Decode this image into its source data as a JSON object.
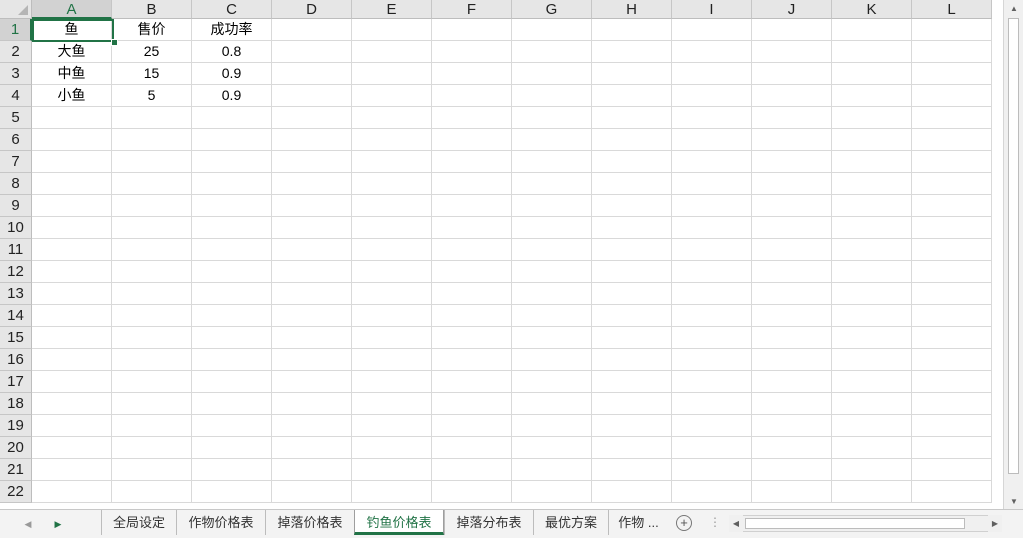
{
  "spreadsheet": {
    "selected_cell": "A1",
    "columns": [
      "A",
      "B",
      "C",
      "D",
      "E",
      "F",
      "G",
      "H",
      "I",
      "J",
      "K",
      "L"
    ],
    "rows": [
      "1",
      "2",
      "3",
      "4",
      "5",
      "6",
      "7",
      "8",
      "9",
      "10",
      "11",
      "12",
      "13",
      "14",
      "15",
      "16",
      "17",
      "18",
      "19",
      "20",
      "21",
      "22"
    ],
    "cells": [
      [
        "鱼",
        "售价",
        "成功率"
      ],
      [
        "大鱼",
        "25",
        "0.8"
      ],
      [
        "中鱼",
        "15",
        "0.9"
      ],
      [
        "小鱼",
        "5",
        "0.9"
      ]
    ]
  },
  "sheet_tabs": {
    "tabs": [
      "全局设定",
      "作物价格表",
      "掉落价格表",
      "钓鱼价格表",
      "掉落分布表",
      "最优方案",
      "作物 ..."
    ],
    "active_index": 3,
    "add_label": "+",
    "split_label": "⋮"
  },
  "icons": {
    "prev-sheet": "triangle-left-icon",
    "next-sheet": "triangle-right-icon",
    "scroll-up": "triangle-up-icon",
    "scroll-down": "triangle-down-icon",
    "scroll-left": "triangle-left-icon",
    "scroll-right": "triangle-right-icon"
  },
  "colors": {
    "accent": "#217346",
    "header_bg": "#e6e6e6",
    "gridline": "#d9d9d9"
  }
}
